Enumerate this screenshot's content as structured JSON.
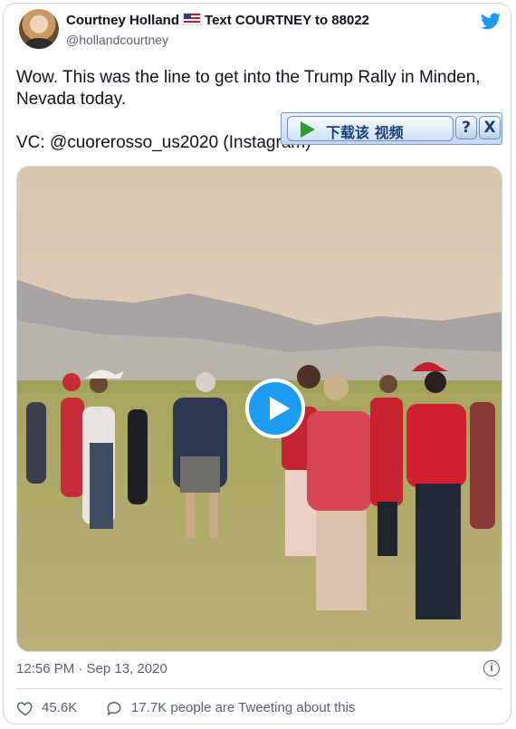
{
  "tweet": {
    "display_name": "Courtney Holland",
    "flag_icon": "us-flag-icon",
    "name_suffix": "Text COURTNEY to 88022",
    "handle": "@hollandcourtney",
    "text": "Wow. This was the line to get into the Trump Rally in Minden, Nevada today.\n\nVC: @cuorerosso_us2020 (Instagram)",
    "timestamp": "12:56 PM · Sep 13, 2020",
    "likes": "45.6K",
    "tweeting": "17.7K people are Tweeting about this"
  },
  "download_bar": {
    "label": "下载该 视频",
    "help_label": "?",
    "close_label": "X"
  },
  "colors": {
    "accent": "#1d9bf0",
    "text_secondary": "#536471",
    "border": "#cfd9de"
  },
  "icons": {
    "logo": "twitter-bird-icon",
    "play": "play-icon",
    "info": "info-icon",
    "like": "heart-icon",
    "reply": "speech-bubble-icon"
  }
}
